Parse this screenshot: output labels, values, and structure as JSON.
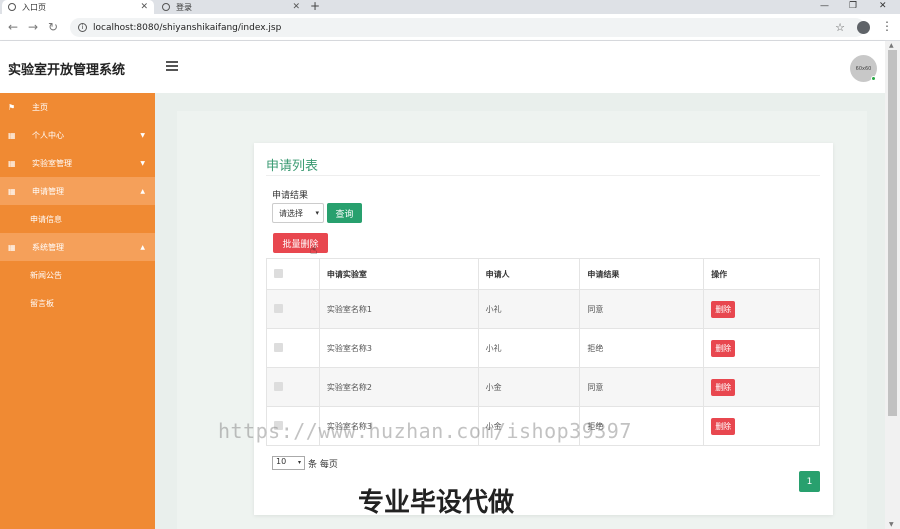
{
  "browser": {
    "tabs": [
      {
        "title": "入口页",
        "active": true
      },
      {
        "title": "登录",
        "active": false
      }
    ],
    "url": "localhost:8080/shiyanshikaifang/index.jsp"
  },
  "header": {
    "title": "实验室开放管理系统",
    "avatar_text": "60x60"
  },
  "sidebar": {
    "items": [
      {
        "label": "主页",
        "icon": "flag-icon"
      },
      {
        "label": "个人中心",
        "icon": "grid-icon",
        "caret": "▼"
      },
      {
        "label": "实验室管理",
        "icon": "grid-icon",
        "caret": "▼"
      },
      {
        "label": "申请管理",
        "icon": "grid-icon",
        "caret": "▲"
      },
      {
        "label": "申请信息"
      },
      {
        "label": "系统管理",
        "icon": "grid-icon",
        "caret": "▲"
      },
      {
        "label": "新闻公告"
      },
      {
        "label": "留言板"
      }
    ]
  },
  "main": {
    "title": "申请列表",
    "filter_label": "申请结果",
    "select_value": "请选择",
    "query_label": "查询",
    "batch_delete_label": "批量删除",
    "columns": [
      "申请实验室",
      "申请人",
      "申请结果",
      "操作"
    ],
    "rows": [
      {
        "lab": "实验室名称1",
        "applicant": "小礼",
        "result": "同意",
        "action": "删除"
      },
      {
        "lab": "实验室名称3",
        "applicant": "小礼",
        "result": "拒绝",
        "action": "删除"
      },
      {
        "lab": "实验室名称2",
        "applicant": "小金",
        "result": "同意",
        "action": "删除"
      },
      {
        "lab": "实验室名称3",
        "applicant": "小金",
        "result": "拒绝",
        "action": "删除"
      }
    ],
    "page_size": "10",
    "page_size_suffix": "条 每页",
    "current_page": "1"
  },
  "watermark": {
    "url": "https://www.huzhan.com/ishop39397",
    "text": "专业毕设代做"
  },
  "colors": {
    "sidebar": "#f08a33",
    "accent_green": "#28a06e",
    "danger": "#e8474f"
  }
}
